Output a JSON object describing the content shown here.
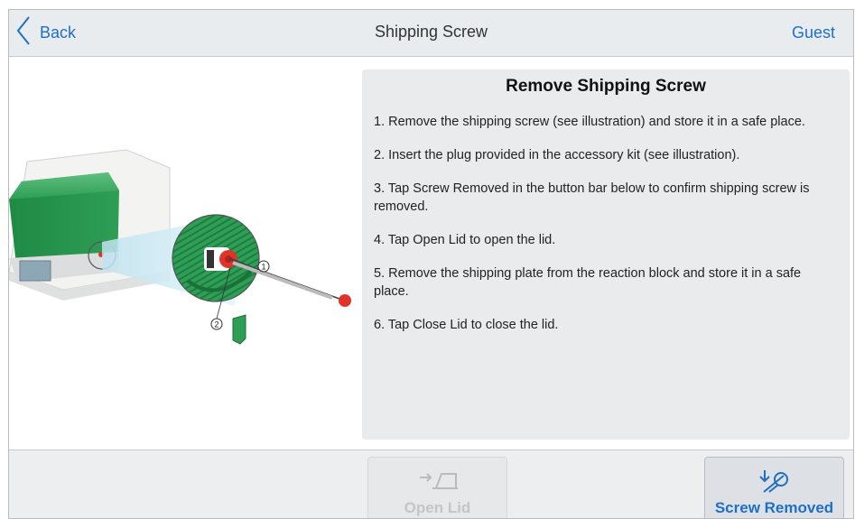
{
  "header": {
    "back_label": "Back",
    "title": "Shipping Screw",
    "user": "Guest"
  },
  "illustration": {
    "callout_1": "1",
    "callout_2": "2"
  },
  "panel": {
    "title": "Remove Shipping Screw",
    "steps": [
      "1. Remove the shipping screw (see illustration) and store it in a safe place.",
      "2. Insert the plug provided in the accessory kit (see illustration).",
      "3. Tap Screw Removed in the button bar below to confirm shipping screw is removed.",
      "4. Tap Open Lid to open the lid.",
      "5. Remove the shipping plate from the reaction block and store it in a safe place.",
      "6. Tap Close Lid to close the lid."
    ]
  },
  "footer": {
    "open_lid_label": "Open Lid",
    "screw_removed_label": "Screw Removed"
  },
  "colors": {
    "accent": "#1f6fc5",
    "instrument_green": "#2e9e55",
    "screw_red": "#e0342b"
  }
}
